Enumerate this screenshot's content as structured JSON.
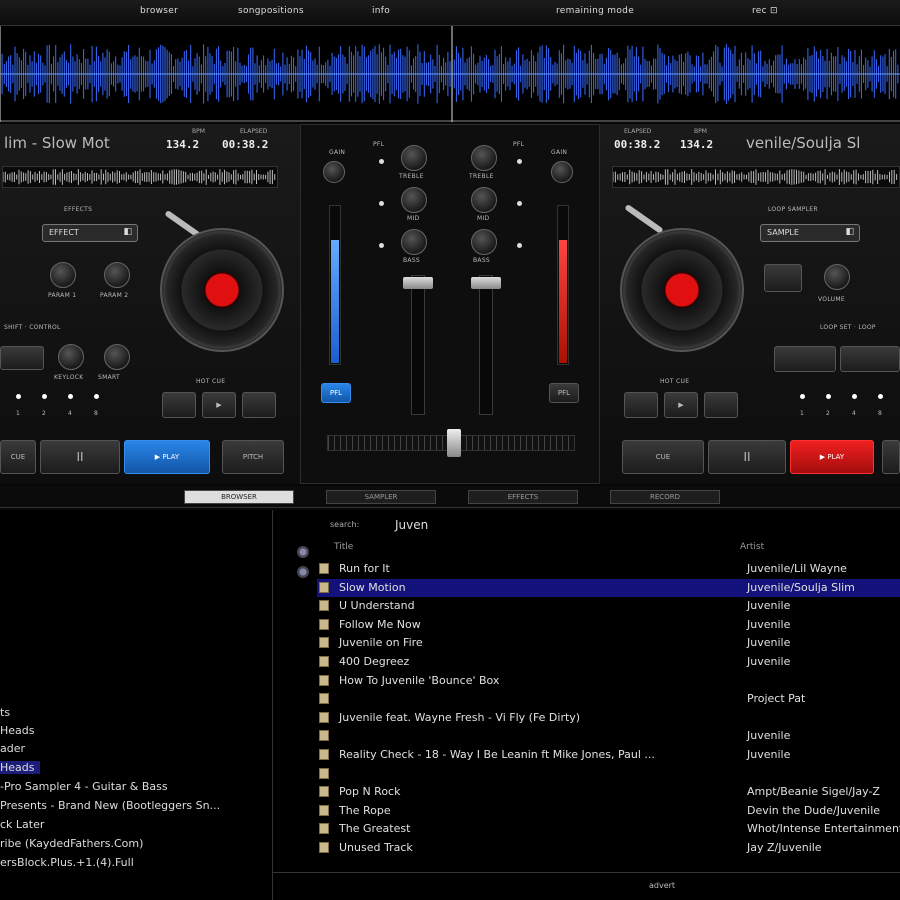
{
  "topbar": {
    "items": [
      "browser",
      "songpositions",
      "info",
      "remaining mode",
      "rec ⊡"
    ]
  },
  "deck_left": {
    "title": "lim - Slow Mot",
    "bpm_label": "BPM",
    "bpm": "134.2",
    "elapsed_label": "ELAPSED",
    "elapsed": "00:38.2",
    "effects_label": "EFFECTS",
    "effect_selected": "EFFECT",
    "param1_label": "PARAM 1",
    "param2_label": "PARAM 2",
    "control_label": "SHIFT · CONTROL",
    "keylock_label": "KEYLOCK",
    "smart_label": "SMART",
    "hotcue_label": "HOT CUE",
    "cue_label": "CUE",
    "pause_label": "II",
    "play_label": "▶ PLAY",
    "pitch_label": "PITCH",
    "loop_values": [
      "1",
      "2",
      "4",
      "8"
    ]
  },
  "deck_right": {
    "title": "venile/Soulja Sl",
    "bpm_label": "BPM",
    "bpm": "134.2",
    "elapsed_label": "ELAPSED",
    "elapsed": "00:38.2",
    "sampler_label": "LOOP SAMPLER",
    "sampler_selected": "SAMPLE",
    "volume_label": "VOLUME",
    "loop_label": "LOOP SET · LOOP",
    "hotcue_label": "HOT CUE",
    "cue_label": "CUE",
    "pause_label": "II",
    "play_label": "▶ PLAY",
    "loop_values": [
      "1",
      "2",
      "4",
      "8"
    ]
  },
  "mixer": {
    "gain_label": "GAIN",
    "treble_label": "TREBLE",
    "mid_label": "MID",
    "bass_label": "BASS",
    "pfl_label": "PFL",
    "level_left": 0.78,
    "level_right": 0.78
  },
  "tabs": [
    "browser",
    "sampler",
    "effects",
    "record"
  ],
  "folders": [
    "ts",
    "Heads",
    "ader",
    "Heads",
    "-Pro Sampler 4 - Guitar & Bass",
    "Presents - Brand New (Bootleggers Sn...",
    "ck Later",
    "ribe (KaydedFathers.Com)",
    "ersBlock.Plus.+1.(4).Full"
  ],
  "browser": {
    "search_label": "search:",
    "search_value": "Juven",
    "col_title": "Title",
    "col_artist": "Artist",
    "rows": [
      {
        "title": "Run for It",
        "artist": "Juvenile/Lil Wayne"
      },
      {
        "title": "Slow Motion",
        "artist": "Juvenile/Soulja Slim"
      },
      {
        "title": "U Understand",
        "artist": "Juvenile"
      },
      {
        "title": "Follow Me Now",
        "artist": "Juvenile"
      },
      {
        "title": "Juvenile on Fire",
        "artist": "Juvenile"
      },
      {
        "title": "400 Degreez",
        "artist": "Juvenile"
      },
      {
        "title": "How To Juvenile 'Bounce' Box",
        "artist": ""
      },
      {
        "title": "",
        "artist": "Project Pat"
      },
      {
        "title": "Juvenile feat. Wayne Fresh - Vi Fly (Fe Dirty)",
        "artist": ""
      },
      {
        "title": "",
        "artist": "Juvenile"
      },
      {
        "title": "Reality Check - 18 - Way I Be Leanin ft Mike Jones, Paul ...",
        "artist": "Juvenile"
      },
      {
        "title": "",
        "artist": ""
      },
      {
        "title": "Pop N Rock",
        "artist": "Ampt/Beanie Sigel/Jay-Z"
      },
      {
        "title": "The Rope",
        "artist": "Devin the Dude/Juvenile"
      },
      {
        "title": "The Greatest",
        "artist": "Whot/Intense Entertainment"
      },
      {
        "title": "Unused Track",
        "artist": "Jay Z/Juvenile"
      }
    ],
    "selected_index": 1,
    "status": "advert"
  },
  "colors": {
    "accent_blue": "#2a86e8",
    "accent_red": "#e01010",
    "selection": "#12127a"
  }
}
